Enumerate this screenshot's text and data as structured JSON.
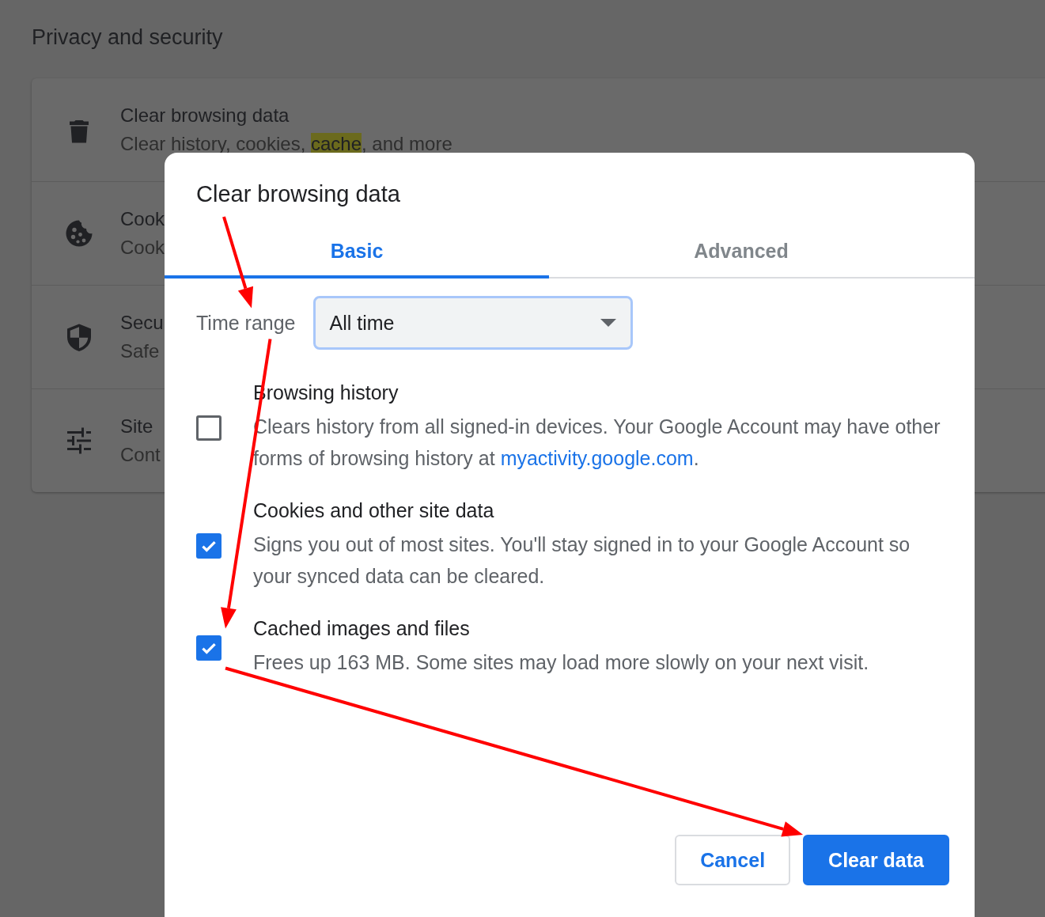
{
  "page": {
    "section_title": "Privacy and security",
    "rows": [
      {
        "title": "Clear browsing data",
        "subtitle": [
          {
            "text": "Clear history, cookies, ",
            "highlight": false
          },
          {
            "text": "cache",
            "highlight": true
          },
          {
            "text": ", and more",
            "highlight": false
          }
        ]
      },
      {
        "title": "Cook",
        "subtitle": [
          {
            "text": "Cook",
            "highlight": false
          }
        ]
      },
      {
        "title": "Secu",
        "subtitle": [
          {
            "text": "Safe",
            "highlight": false
          }
        ]
      },
      {
        "title": "Site",
        "subtitle": [
          {
            "text": "Cont",
            "highlight": false
          }
        ]
      }
    ]
  },
  "dialog": {
    "title": "Clear browsing data",
    "tabs": [
      {
        "label": "Basic",
        "selected": true
      },
      {
        "label": "Advanced",
        "selected": false
      }
    ],
    "time_range": {
      "label": "Time range",
      "value": "All time"
    },
    "options": [
      {
        "title": "Browsing history",
        "description": "Clears history from all signed-in devices. Your Google Account may have other forms of browsing history at ",
        "link": "myactivity.google.com",
        "after": ".",
        "checked": false
      },
      {
        "title": "Cookies and other site data",
        "description": "Signs you out of most sites. You'll stay signed in to your Google Account so your synced data can be cleared.",
        "checked": true
      },
      {
        "title": "Cached images and files",
        "description": "Frees up 163 MB. Some sites may load more slowly on your next visit.",
        "checked": true
      }
    ],
    "buttons": [
      {
        "label": "Cancel",
        "kind": "secondary"
      },
      {
        "label": "Clear data",
        "kind": "primary"
      }
    ]
  },
  "arrows": [
    {
      "kind": "arrow"
    },
    {
      "kind": "arrow"
    },
    {
      "kind": "arrow"
    }
  ]
}
